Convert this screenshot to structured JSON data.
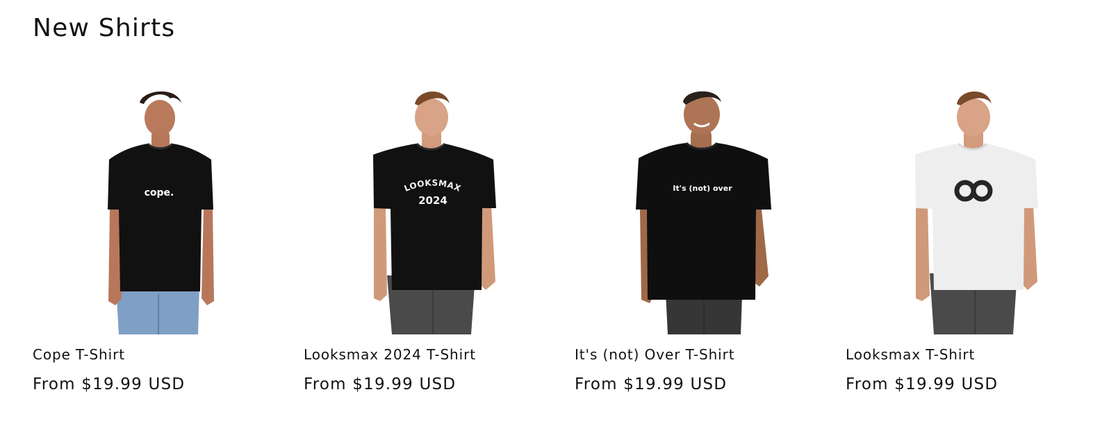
{
  "section": {
    "title": "New Shirts"
  },
  "products": [
    {
      "title": "Cope T-Shirt",
      "price": "From $19.99 USD",
      "shirt_print": "cope.",
      "shirt_color": "#111111",
      "print_color": "#ffffff",
      "icon": "cope-shirt-image"
    },
    {
      "title": "Looksmax 2024 T-Shirt",
      "price": "From $19.99 USD",
      "shirt_print_line1": "LOOKSMAX",
      "shirt_print_line2": "2024",
      "shirt_color": "#111111",
      "print_color": "#f2f2f2",
      "icon": "looksmax-2024-shirt-image"
    },
    {
      "title": "It's (not) Over T-Shirt",
      "price": "From $19.99 USD",
      "shirt_print": "It's (not) over",
      "shirt_color": "#0f0f0f",
      "print_color": "#ffffff",
      "icon": "its-not-over-shirt-image"
    },
    {
      "title": "Looksmax T-Shirt",
      "price": "From $19.99 USD",
      "shirt_color": "#eeeeee",
      "print_color": "#252525",
      "icon": "looksmax-logo-shirt-image"
    }
  ]
}
